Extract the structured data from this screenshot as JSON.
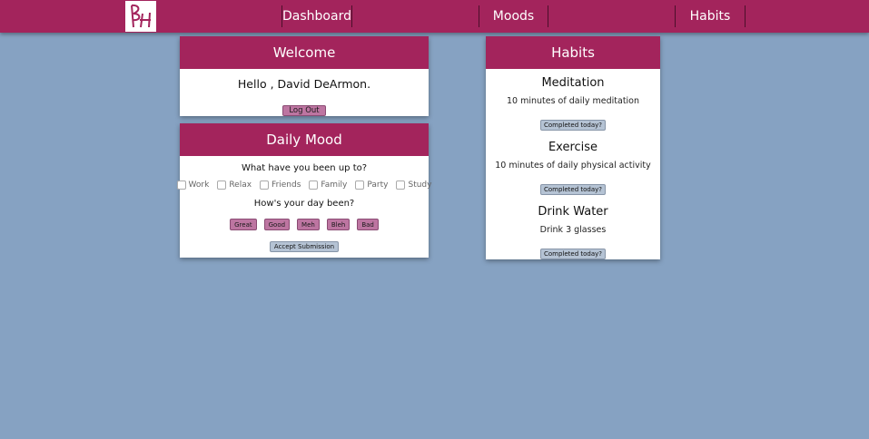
{
  "nav": {
    "logo_text": "BH",
    "links": [
      "Dashboard",
      "Moods",
      "Habits"
    ]
  },
  "welcome": {
    "title": "Welcome",
    "greeting": "Hello , David DeArmon.",
    "logout_label": "Log Out"
  },
  "daily_mood": {
    "title": "Daily Mood",
    "question1": "What have you been up to?",
    "activities": [
      "Work",
      "Relax",
      "Friends",
      "Family",
      "Party",
      "Study"
    ],
    "question2": "How's your day been?",
    "moods": [
      "Great",
      "Good",
      "Meh",
      "Bleh",
      "Bad"
    ],
    "submit_label": "Accept Submission"
  },
  "habits": {
    "title": "Habits",
    "items": [
      {
        "name": "Meditation",
        "description": "10 minutes of daily meditation",
        "button": "Completed today?"
      },
      {
        "name": "Exercise",
        "description": "10 minutes of daily physical activity",
        "button": "Completed today?"
      },
      {
        "name": "Drink Water",
        "description": "Drink 3 glasses",
        "button": "Completed today?"
      }
    ]
  },
  "colors": {
    "brand": "#a3245c",
    "background": "#86a2c2",
    "pink_button": "#bd75a1",
    "blue_button": "#b5c3d4"
  }
}
